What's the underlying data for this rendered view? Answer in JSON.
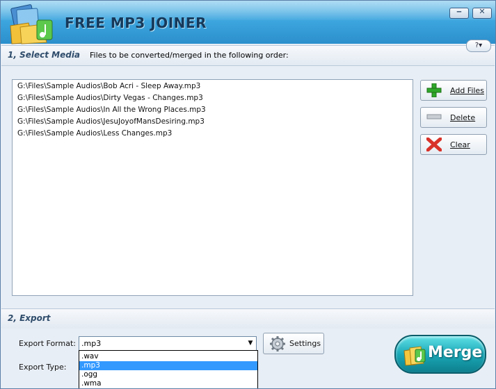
{
  "app": {
    "title": "FREE MP3 JOINER",
    "help_label": "?▾",
    "minimize_icon": "minimize-icon",
    "close_icon": "close-icon"
  },
  "select_media": {
    "section_title": "1, Select Media",
    "order_note": "Files to be converted/merged in the following order:",
    "files": [
      "G:\\Files\\Sample Audios\\Bob Acri - Sleep Away.mp3",
      "G:\\Files\\Sample Audios\\Dirty Vegas - Changes.mp3",
      "G:\\Files\\Sample Audios\\In All the Wrong Places.mp3",
      "G:\\Files\\Sample Audios\\JesuJoyofMansDesiring.mp3",
      "G:\\Files\\Sample Audios\\Less Changes.mp3"
    ],
    "add_files_label": "Add Files",
    "delete_label": "Delete",
    "clear_label": "Clear"
  },
  "export": {
    "section_title": "2, Export",
    "format_label": "Export Format:",
    "type_label": "Export Type:",
    "format_value": ".mp3",
    "format_options": [
      ".wav",
      ".mp3",
      ".ogg",
      ".wma"
    ],
    "selected_option": ".mp3",
    "settings_label": "Settings",
    "merge_label": "Merge"
  },
  "colors": {
    "titlebar": "#3ea6df",
    "selection": "#3399ff",
    "merge": "#1aa8b7",
    "add_icon": "#2fa82a",
    "clear_icon": "#d8322a"
  }
}
